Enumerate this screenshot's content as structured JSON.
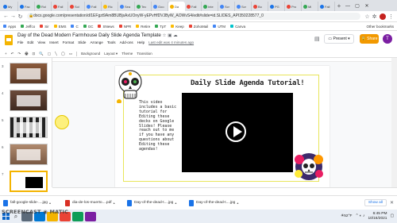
{
  "browser": {
    "tabs": [
      {
        "label": "My",
        "color": "#1a73e8"
      },
      {
        "label": "Fac",
        "color": "#1a73e8"
      },
      {
        "label": "Rol",
        "color": "#34a853"
      },
      {
        "label": "Fall",
        "color": "#ea4335"
      },
      {
        "label": "Sol",
        "color": "#ea4335"
      },
      {
        "label": "Fall",
        "color": "#4285f4"
      },
      {
        "label": "Ric",
        "color": "#fbbc04"
      },
      {
        "label": "Sea",
        "color": "#4285f4"
      },
      {
        "label": "Tec",
        "color": "#34a853"
      },
      {
        "label": "Goo",
        "color": "#4285f4"
      },
      {
        "label": "Da",
        "color": "#f4b400",
        "active": true
      },
      {
        "label": "Fall",
        "color": "#ea4335"
      },
      {
        "label": "Inte",
        "color": "#34a853"
      },
      {
        "label": "Scr",
        "color": "#4285f4"
      },
      {
        "label": "Scr",
        "color": "#4285f4"
      },
      {
        "label": "Bo",
        "color": "#ea4335"
      },
      {
        "label": "PG",
        "color": "#1a73e8"
      },
      {
        "label": "Pro",
        "color": "#ea4335"
      },
      {
        "label": "Mi",
        "color": "#34a853"
      },
      {
        "label": "Fall",
        "color": "#1a73e8"
      }
    ],
    "new_tab": "+",
    "url": "docs.google.com/presentation/d/1EFgzt9Am8BUBjsAxUOnyW-yEPvHfDVJByW_AOWvS4/edit#slide=id.SLIDES_API350228577_0",
    "bookmarks": [
      {
        "label": "Apps",
        "color": "#4285f4"
      },
      {
        "label": "Jeffco",
        "color": "#34a853"
      },
      {
        "label": "Sir",
        "color": "#ea4335"
      },
      {
        "label": "EMS",
        "color": "#fbbc04"
      },
      {
        "label": "C",
        "color": "#4285f4"
      },
      {
        "label": "GC",
        "color": "#34a853"
      },
      {
        "label": "SNews",
        "color": "#ea4335"
      },
      {
        "label": "NPR",
        "color": "#ea4335"
      },
      {
        "label": "Retire",
        "color": "#fbbc04"
      },
      {
        "label": "TpT",
        "color": "#34a853"
      },
      {
        "label": "Keep",
        "color": "#fbbc04"
      },
      {
        "label": "ZohoMail",
        "color": "#ea4335"
      },
      {
        "label": "UTM",
        "color": "#4285f4"
      },
      {
        "label": "Canva",
        "color": "#00c4cc"
      }
    ],
    "other_bookmarks": "Other bookmarks"
  },
  "docs": {
    "title": "Day of the Dead Modern Farmhouse Daily Slide Agenda Template",
    "menus": [
      "File",
      "Edit",
      "View",
      "Insert",
      "Format",
      "Slide",
      "Arrange",
      "Tools",
      "Add-ons",
      "Help"
    ],
    "last_edit": "Last edit was 4 minutes ago",
    "present": "Present",
    "share": "Share",
    "avatar_initial": "T",
    "toolbar": [
      "+",
      "↶",
      "↷",
      "🖶",
      "⊡",
      "🔍",
      "▢",
      "╲",
      "◯",
      "▭",
      "Background",
      "Layout ▾",
      "Theme",
      "Transition"
    ]
  },
  "slides": [
    {
      "num": "3"
    },
    {
      "num": "4"
    },
    {
      "num": "5"
    },
    {
      "num": "6"
    },
    {
      "num": "7",
      "selected": true
    }
  ],
  "slide": {
    "title": "Daily Slide Agenda Tutorial!",
    "body": "This video includes a basic tutorial for Editing these decks on Google Slides! Please reach out to me if you have any questions about Editing these agendas!"
  },
  "downloads": [
    {
      "name": "fall-google-slide-....jpg"
    },
    {
      "name": "dia-de-los-muerto....pdf"
    },
    {
      "name": "Day-of-the-dead-t....jpg"
    },
    {
      "name": "Day-of-the-dead-t....jpg"
    }
  ],
  "show_all": "Show all",
  "taskbar": {
    "weather": "52°F",
    "time": "6:45 PM",
    "date": "10/16/2021"
  },
  "watermark": "SCREENCAST ◉ MATIC",
  "colors": {
    "accent": "#f4b400",
    "frame": "#e8e55a",
    "share": "#f29900"
  }
}
